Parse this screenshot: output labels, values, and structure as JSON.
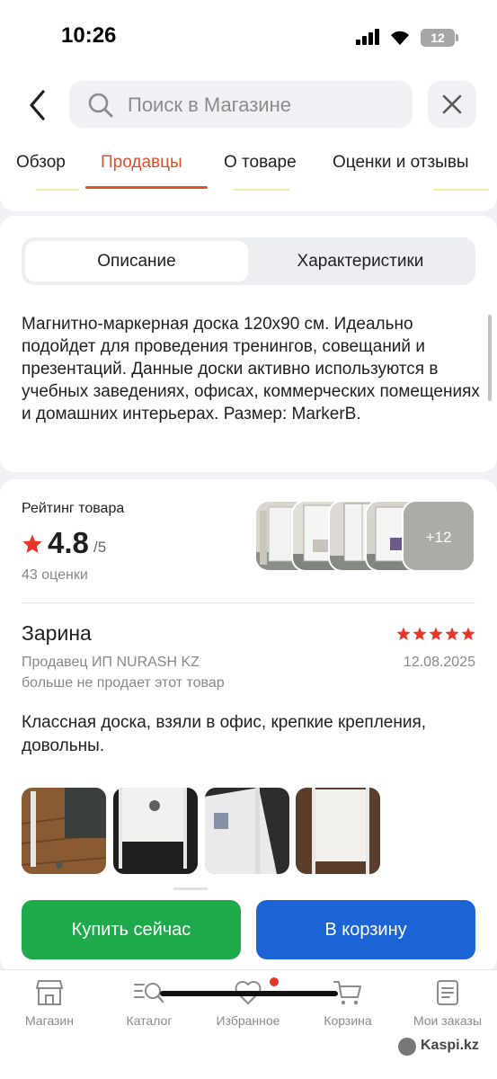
{
  "status_bar": {
    "time": "10:26",
    "battery": "12"
  },
  "header": {
    "search_placeholder": "Поиск в Магазине",
    "tabs": [
      {
        "label": "Обзор"
      },
      {
        "label": "Продавцы",
        "active": true
      },
      {
        "label": "О товаре"
      },
      {
        "label": "Оценки и отзывы"
      }
    ]
  },
  "description": {
    "segments": [
      "Описание",
      "Характеристики"
    ],
    "active_segment": "Описание",
    "text": "Магнитно-маркерная доска 120x90 см. Идеально подойдет для проведения тренингов, совещаний и презентаций. Данные доски активно используются в учебных заведениях, офисах, коммерческих помещениях и домашних интерьерах. Размер: MarkerB."
  },
  "rating": {
    "label": "Рейтинг товара",
    "value": "4.8",
    "max": "/5",
    "count": "43 оценки",
    "more_photos": "+12"
  },
  "review": {
    "author": "Зарина",
    "stars": 5,
    "seller": "Продавец ИП NURASH KZ",
    "date": "12.08.2025",
    "seller_note": "больше не продает этот товар",
    "text": "Классная доска, взяли в офис, крепкие крепления, довольны."
  },
  "actions": {
    "buy_now": "Купить сейчас",
    "add_to_cart": "В корзину"
  },
  "tabbar": {
    "items": [
      {
        "label": "Магазин",
        "icon": "shop-icon"
      },
      {
        "label": "Каталог",
        "icon": "catalog-icon"
      },
      {
        "label": "Избранное",
        "icon": "heart-icon"
      },
      {
        "label": "Корзина",
        "icon": "cart-icon"
      },
      {
        "label": "Мои заказы",
        "icon": "orders-icon"
      }
    ]
  },
  "watermark": "Kaspi.kz",
  "colors": {
    "accent": "#e14f2a",
    "buy": "#1ea94a",
    "cart": "#1c64d6",
    "star": "#e8352a"
  }
}
